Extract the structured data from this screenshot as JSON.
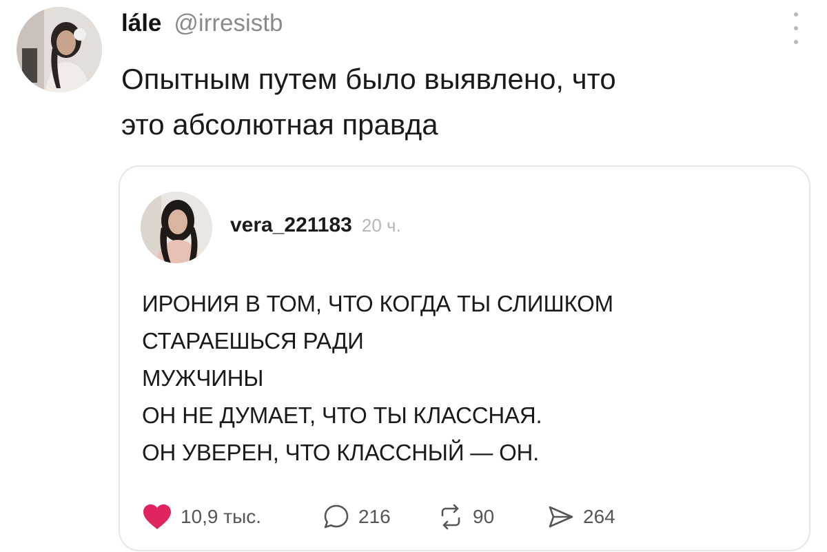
{
  "tweet": {
    "display_name": "lále",
    "handle": "@irresistb",
    "text_lines": [
      "Опытным путем было выявлено, что",
      "это абсолютная правда"
    ]
  },
  "quote": {
    "username": "vera_221183",
    "time": "20 ч.",
    "lines": [
      "ИРОНИЯ В ТОМ, ЧТО КОГДА ТЫ СЛИШКОМ",
      "СТАРАЕШЬСЯ РАДИ",
      "МУЖЧИНЫ",
      "ОН НЕ ДУМАЕТ, ЧТО ТЫ КЛАССНАЯ.",
      "ОН УВЕРЕН, ЧТО КЛАССНЫЙ — ОН."
    ],
    "actions": {
      "likes": "10,9 тыс.",
      "comments": "216",
      "reposts": "90",
      "shares": "264"
    }
  },
  "icons": {
    "like": "heart-icon",
    "comment": "comment-bubble-icon",
    "repost": "repost-icon",
    "share": "send-icon",
    "more": "more-vertical-icon"
  },
  "colors": {
    "like": "#e0245e",
    "muted": "#8a8a8a"
  }
}
